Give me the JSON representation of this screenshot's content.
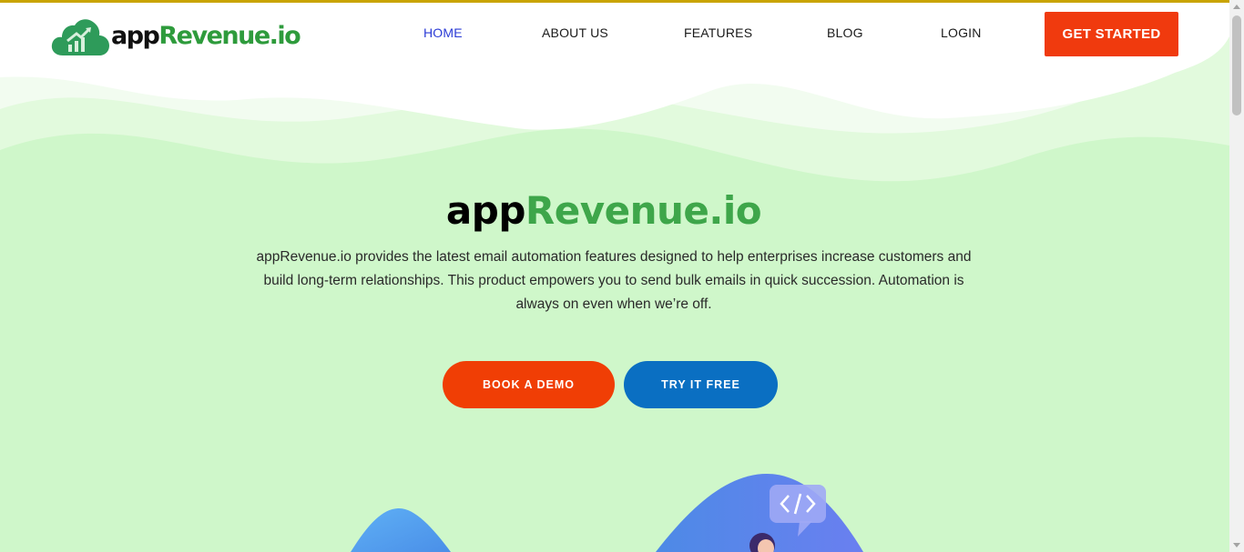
{
  "brand": {
    "logo_part1": "app",
    "logo_part2": "Revenue.io"
  },
  "nav": {
    "home": "HOME",
    "about": "ABOUT US",
    "features": "FEATURES",
    "blog": "BLOG",
    "login": "LOGIN",
    "cta": "GET STARTED"
  },
  "hero": {
    "title_part1": "app",
    "title_part2": "Revenue.io",
    "description": "appRevenue.io provides the latest email automation features designed to help enterprises increase customers and build long-term relationships. This product empowers you to send bulk emails in quick succession. Automation is always on even when we’re off.",
    "book_demo": "BOOK A DEMO",
    "try_free": "TRY IT FREE"
  },
  "colors": {
    "accent_orange": "#f03a0e",
    "accent_blue": "#0a6fc2",
    "brand_green": "#2e9b3c",
    "hero_bg": "#cff7ca"
  },
  "icons": [
    "cloud-chart-logo-icon",
    "code-bubble-icon"
  ]
}
